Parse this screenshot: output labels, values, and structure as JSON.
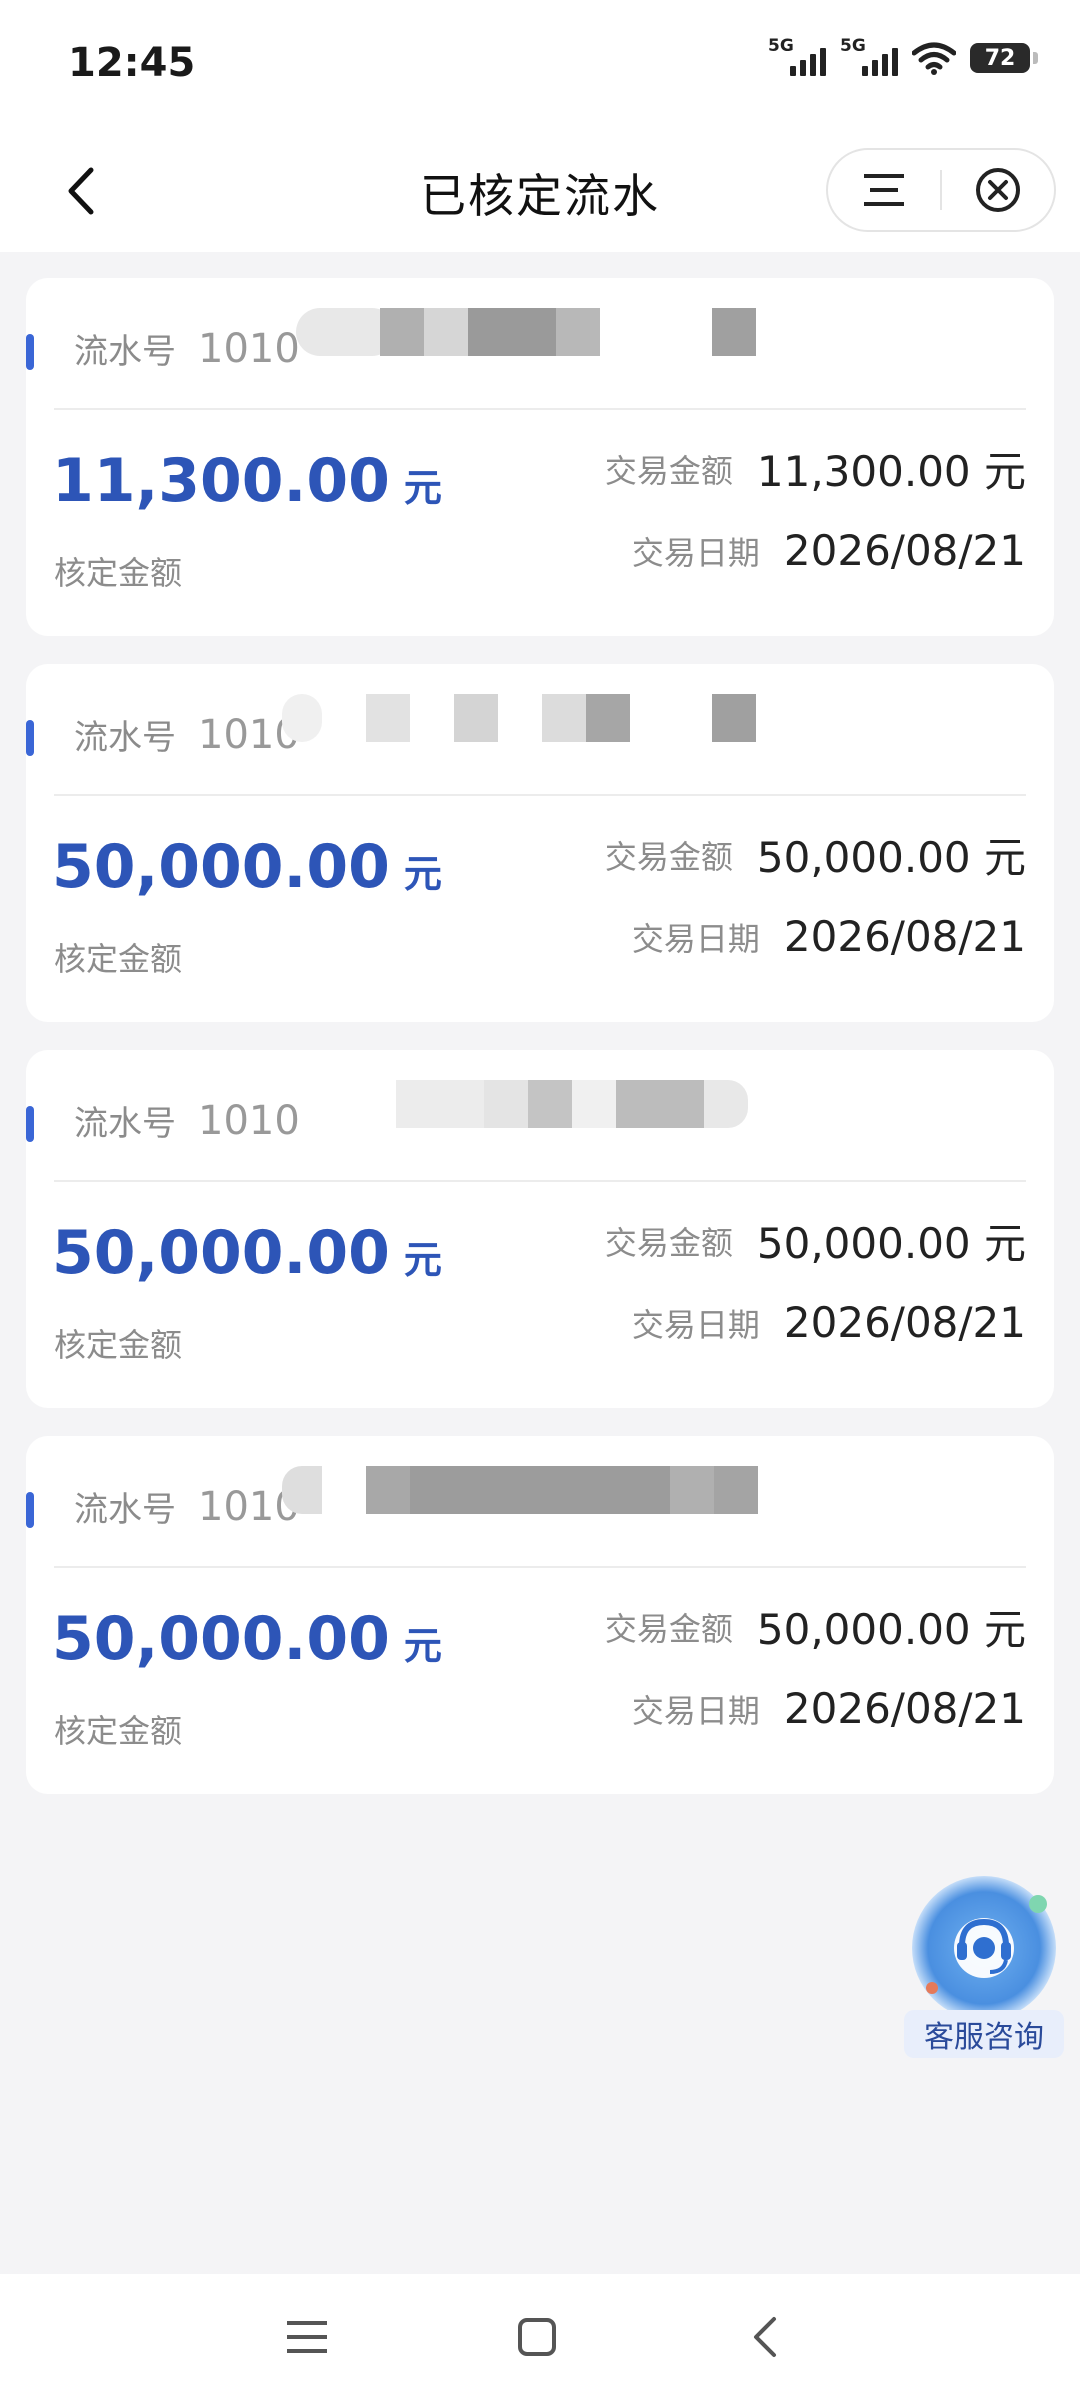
{
  "status_bar": {
    "time": "12:45",
    "network_1": "5G",
    "network_2": "5G",
    "battery": "72"
  },
  "header": {
    "title": "已核定流水"
  },
  "cards": [
    {
      "serial_label": "流水号",
      "serial_visible": "1010",
      "amount_big": "11,300.00",
      "amount_unit": "元",
      "amount_label": "核定金额",
      "trade_amount_label": "交易金额",
      "trade_amount": "11,300.00 元",
      "trade_date_label": "交易日期",
      "trade_date": "2026/08/21"
    },
    {
      "serial_label": "流水号",
      "serial_visible": "1010",
      "amount_big": "50,000.00",
      "amount_unit": "元",
      "amount_label": "核定金额",
      "trade_amount_label": "交易金额",
      "trade_amount": "50,000.00 元",
      "trade_date_label": "交易日期",
      "trade_date": "2026/08/21"
    },
    {
      "serial_label": "流水号",
      "serial_visible": "1010",
      "amount_big": "50,000.00",
      "amount_unit": "元",
      "amount_label": "核定金额",
      "trade_amount_label": "交易金额",
      "trade_amount": "50,000.00 元",
      "trade_date_label": "交易日期",
      "trade_date": "2026/08/21"
    },
    {
      "serial_label": "流水号",
      "serial_visible": "1010",
      "amount_big": "50,000.00",
      "amount_unit": "元",
      "amount_label": "核定金额",
      "trade_amount_label": "交易金额",
      "trade_amount": "50,000.00 元",
      "trade_date_label": "交易日期",
      "trade_date": "2026/08/21"
    }
  ],
  "customer_service": {
    "label": "客服咨询"
  },
  "colors": {
    "accent": "#2d55b7",
    "background": "#f4f4f6"
  },
  "icons": {
    "back": "back-arrow-icon",
    "menu": "menu-icon",
    "close": "close-circle-icon",
    "headset": "headset-icon",
    "sys_menu": "recent-apps-icon",
    "sys_home": "home-icon",
    "sys_back": "back-icon"
  }
}
